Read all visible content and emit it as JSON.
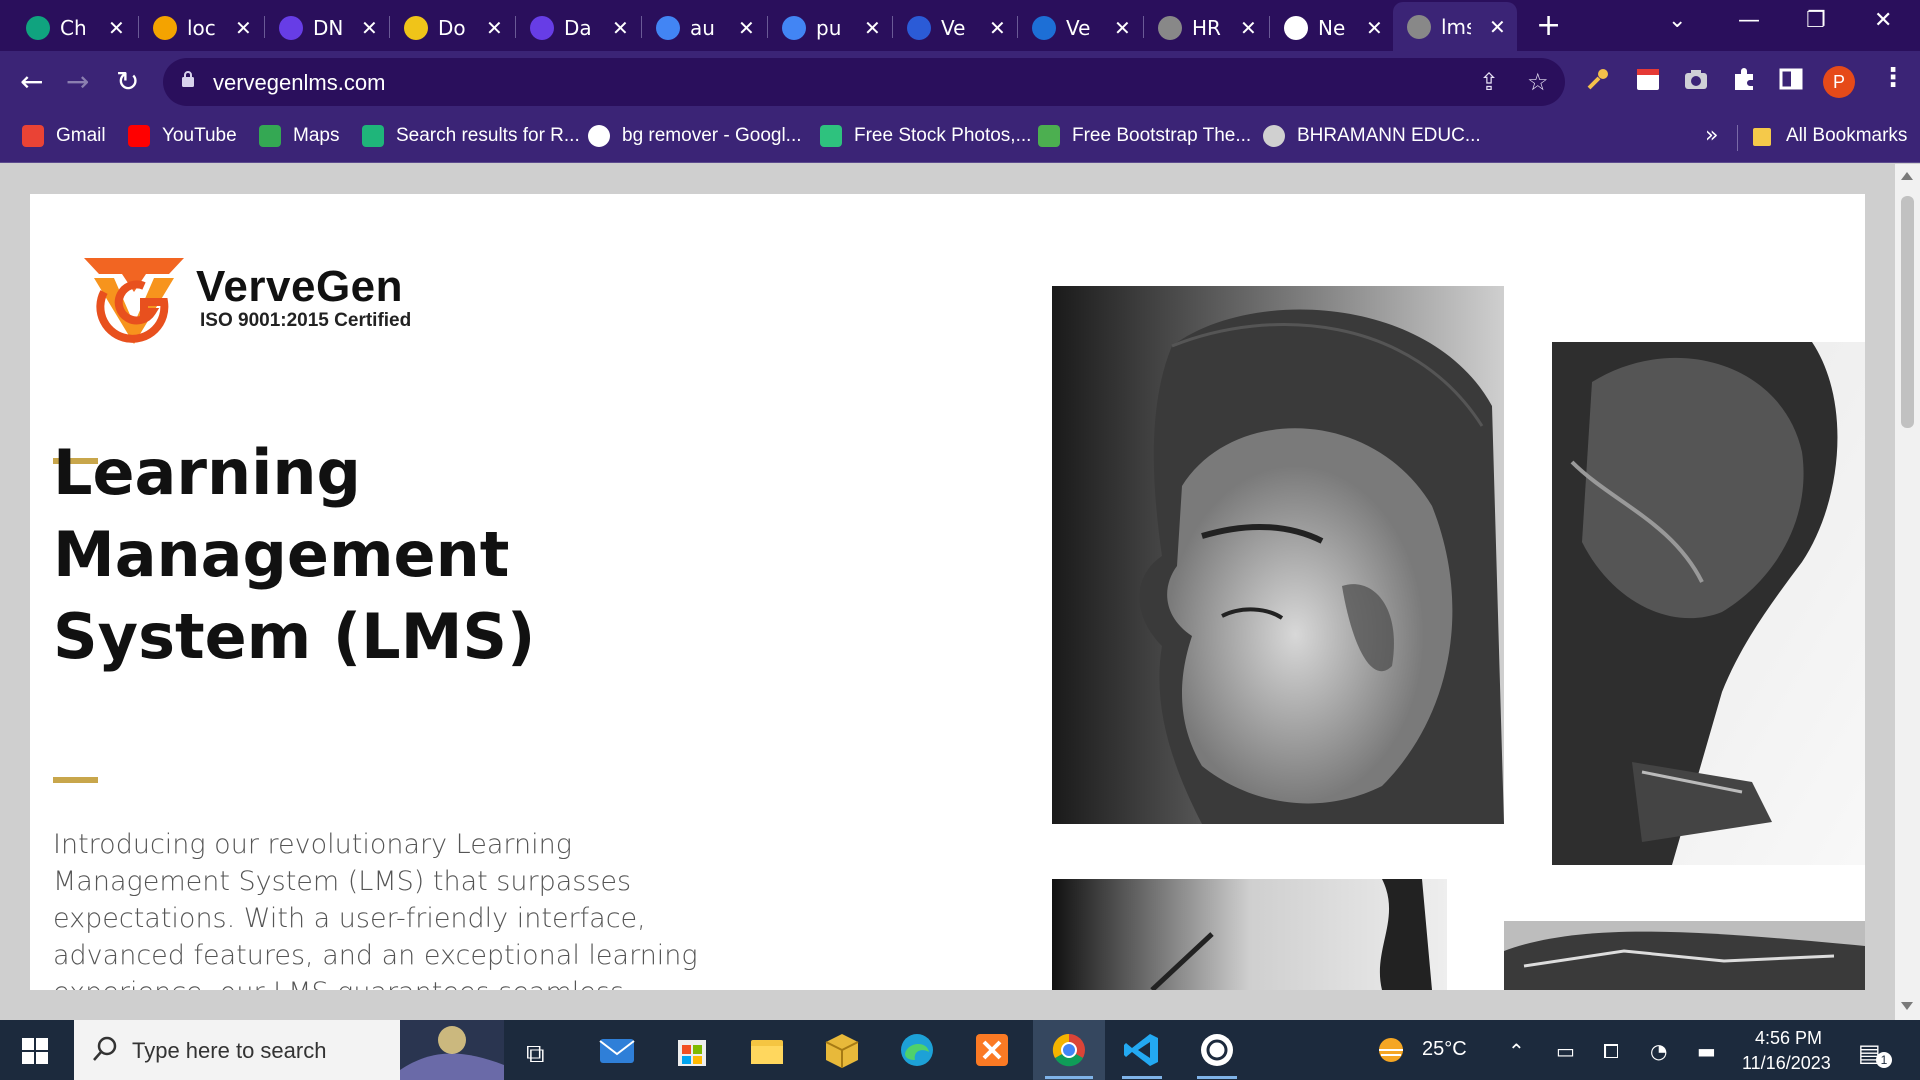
{
  "browser": {
    "tabs": [
      {
        "title": "Ch",
        "icon": "chatgpt-icon",
        "color": "#10a37f"
      },
      {
        "title": "loc",
        "icon": "localhost-icon",
        "color": "#f4a300"
      },
      {
        "title": "DN",
        "icon": "hostinger-icon",
        "color": "#673de6"
      },
      {
        "title": "Do",
        "icon": "doc-icon",
        "color": "#f0c419"
      },
      {
        "title": "Da",
        "icon": "hostinger-icon",
        "color": "#673de6"
      },
      {
        "title": "au",
        "icon": "sheet-icon",
        "color": "#4285f4"
      },
      {
        "title": "pu",
        "icon": "sheet-icon",
        "color": "#4285f4"
      },
      {
        "title": "Ve",
        "icon": "site-icon",
        "color": "#2b5bd7"
      },
      {
        "title": "Ve",
        "icon": "wordpress-icon",
        "color": "#1d6fd6"
      },
      {
        "title": "HR",
        "icon": "globe-icon",
        "color": "#888888"
      },
      {
        "title": "Ne",
        "icon": "chrome-icon",
        "color": "#ffffff"
      },
      {
        "title": "lms",
        "icon": "globe-icon",
        "color": "#888888",
        "active": true
      }
    ],
    "new_tab": "+",
    "url": "vervegenlms.com",
    "profile_initial": "P",
    "more_bookmarks": "»",
    "bookmarks": [
      {
        "label": "Gmail",
        "icon": "gmail-icon"
      },
      {
        "label": "YouTube",
        "icon": "youtube-icon"
      },
      {
        "label": "Maps",
        "icon": "maps-icon"
      },
      {
        "label": "Search results for R...",
        "icon": "vervegen-icon"
      },
      {
        "label": "bg remover - Googl...",
        "icon": "google-icon"
      },
      {
        "label": "Free Stock Photos,...",
        "icon": "stock-icon"
      },
      {
        "label": "Free Bootstrap The...",
        "icon": "bootstrap-icon"
      },
      {
        "label": "BHRAMANN EDUC...",
        "icon": "globe-icon"
      }
    ],
    "all_bookmarks": "All Bookmarks"
  },
  "page": {
    "brand": {
      "name": "VerveGen",
      "tagline": "ISO 9001:2015 Certified"
    },
    "hero": {
      "title": "Learning Management System (LMS)",
      "description": "Introducing our revolutionary Learning Management System (LMS) that surpasses expectations. With a user-friendly interface, advanced features, and an exceptional learning experience, our LMS guarantees seamless navigation and an immersive educational"
    },
    "accent_color": "#c8a64b",
    "logo_color": "#f26522"
  },
  "taskbar": {
    "search_placeholder": "Type here to search",
    "weather": "25°C",
    "time": "4:56 PM",
    "date": "11/16/2023",
    "notification_count": "1"
  }
}
